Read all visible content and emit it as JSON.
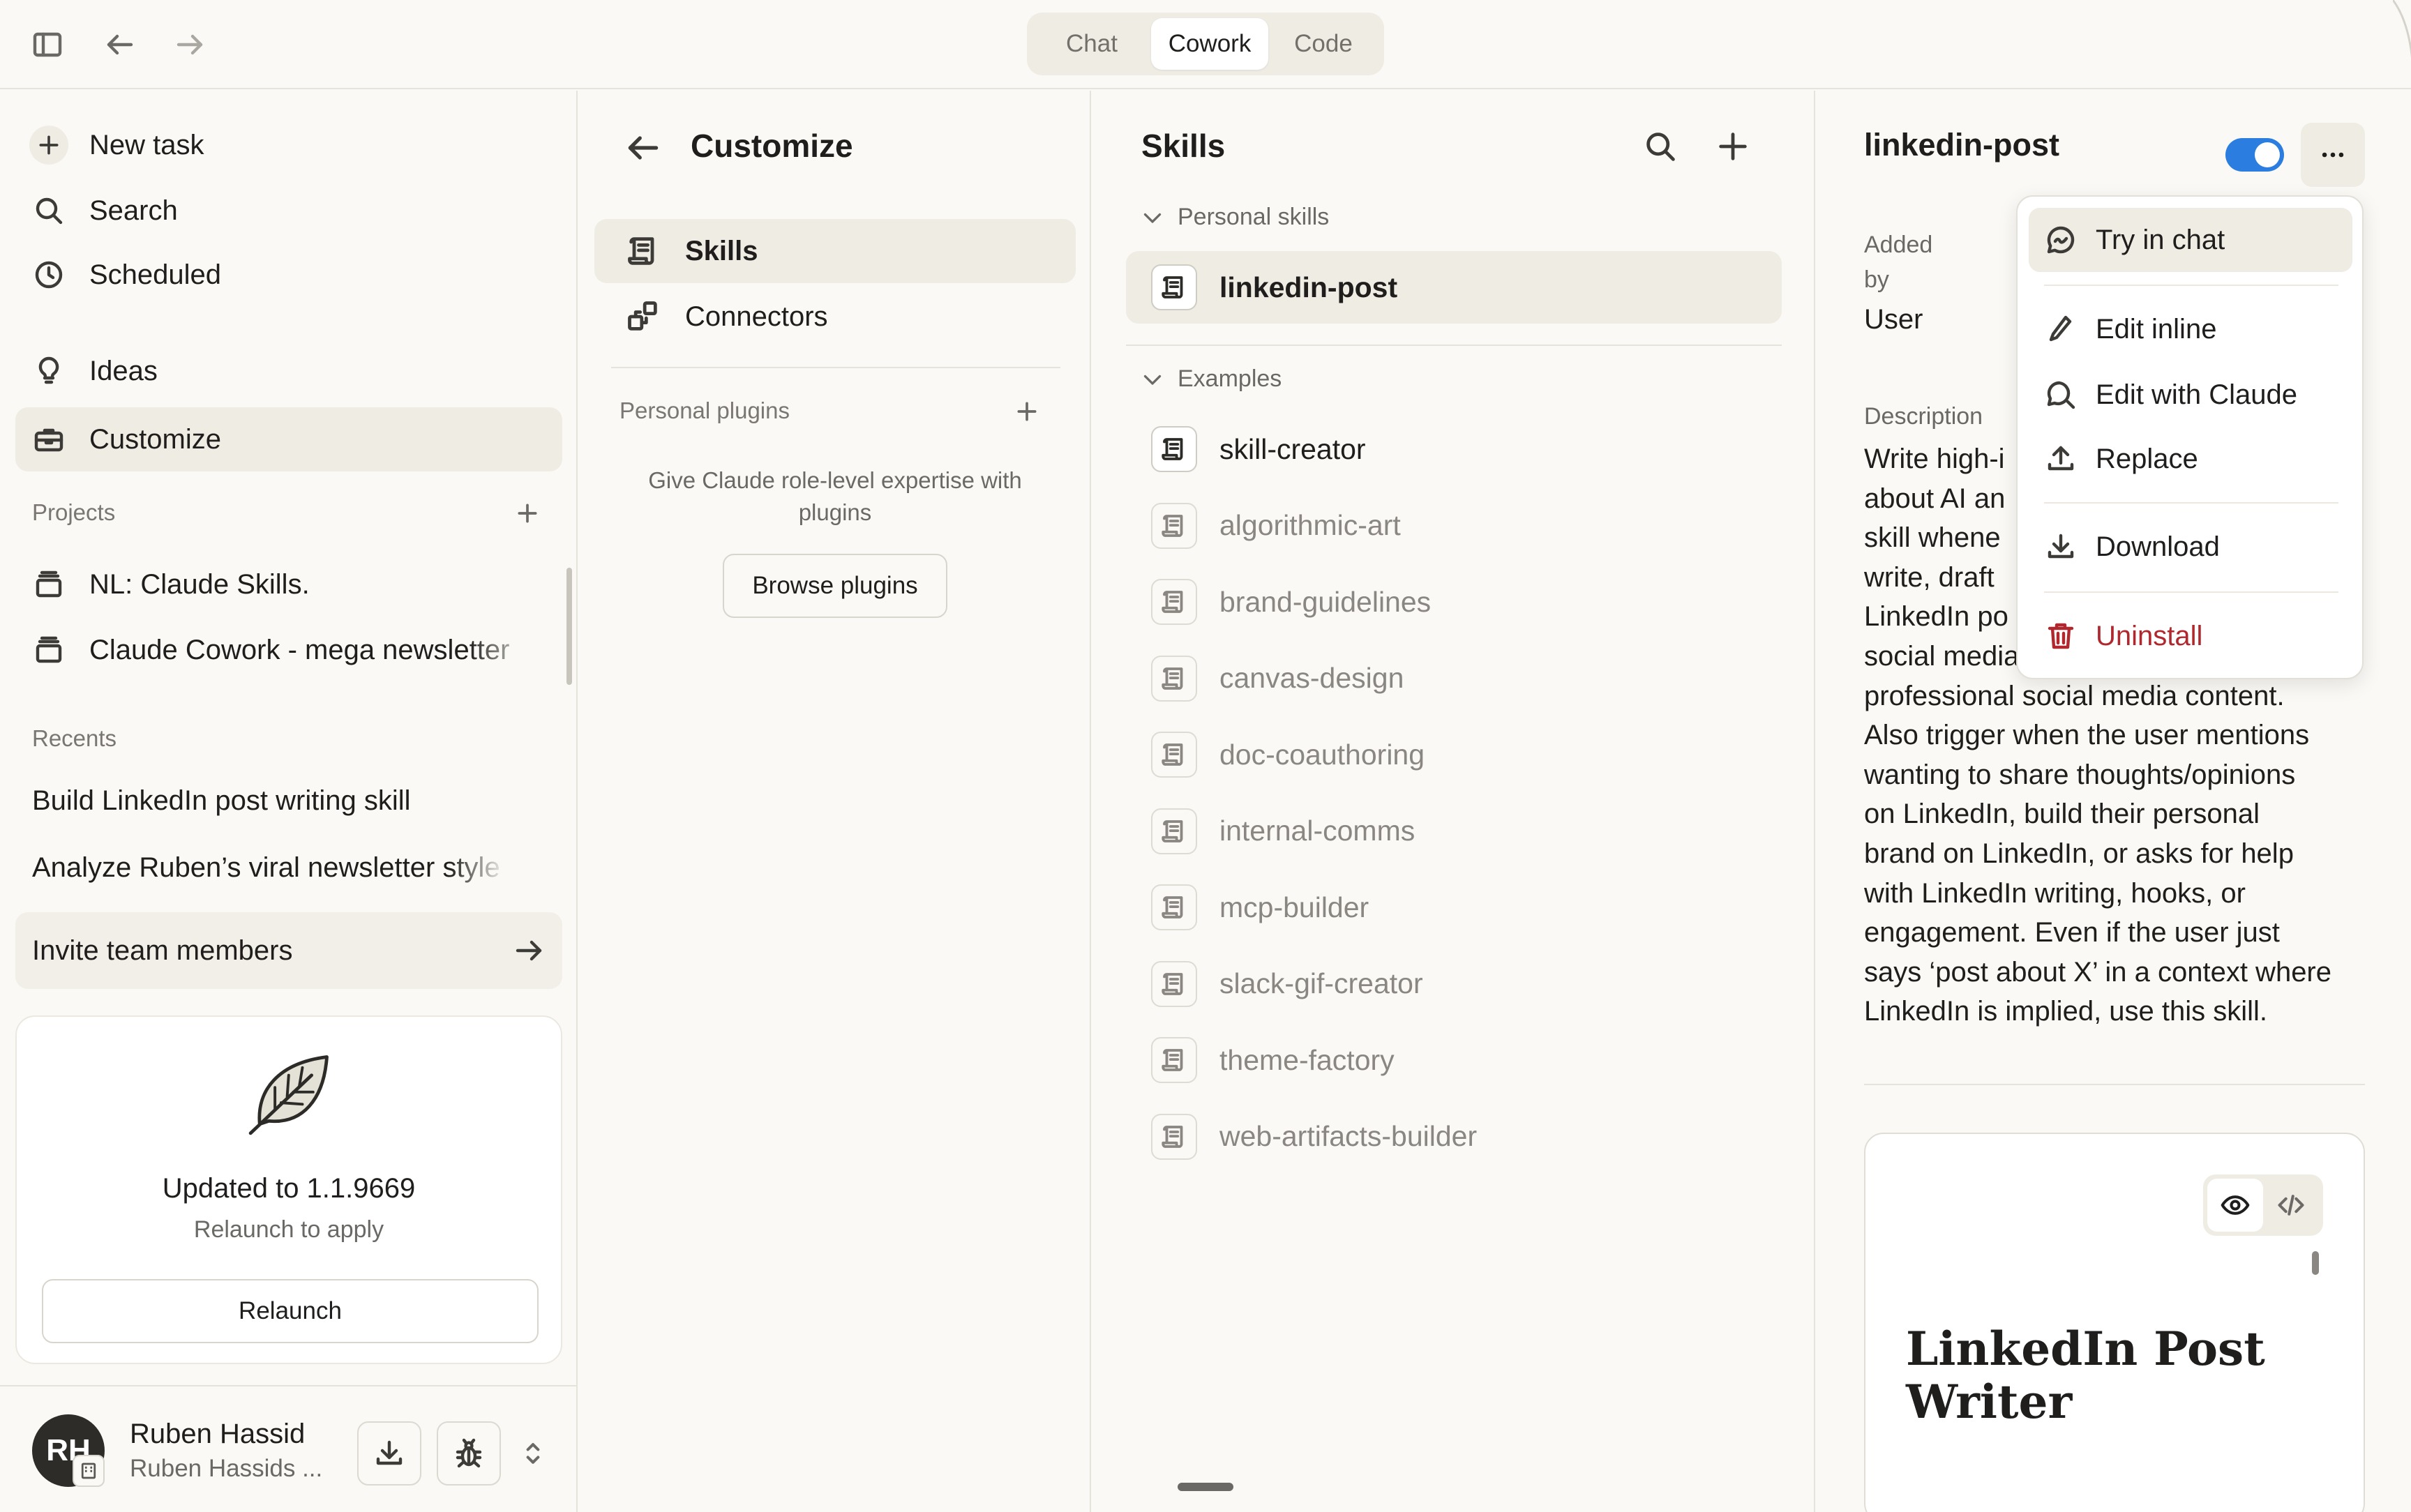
{
  "topbar": {
    "tabs": [
      {
        "label": "Chat",
        "active": false
      },
      {
        "label": "Cowork",
        "active": true
      },
      {
        "label": "Code",
        "active": false
      }
    ]
  },
  "sidebar": {
    "nav": [
      {
        "label": "New task",
        "icon": "plus-icon"
      },
      {
        "label": "Search",
        "icon": "search-icon"
      },
      {
        "label": "Scheduled",
        "icon": "clock-icon"
      },
      {
        "label": "Ideas",
        "icon": "lightbulb-icon"
      },
      {
        "label": "Customize",
        "icon": "toolbox-icon",
        "active": true
      }
    ],
    "projects_label": "Projects",
    "projects": [
      "NL: Claude Skills.",
      "Claude Cowork - mega newsletter"
    ],
    "recents_label": "Recents",
    "recents": [
      "Build LinkedIn post writing skill",
      "Analyze Ruben’s viral newsletter style"
    ],
    "invite_label": "Invite team members",
    "update": {
      "title": "Updated to 1.1.9669",
      "subtitle": "Relaunch to apply",
      "button": "Relaunch"
    },
    "user": {
      "initials": "RH",
      "name": "Ruben Hassid",
      "org": "Ruben Hassids ..."
    }
  },
  "customize": {
    "title": "Customize",
    "items": [
      {
        "label": "Skills",
        "active": true
      },
      {
        "label": "Connectors",
        "active": false
      }
    ],
    "plugins_label": "Personal plugins",
    "plugins_empty": "Give Claude role-level expertise with plugins",
    "browse_button": "Browse plugins"
  },
  "skills": {
    "title": "Skills",
    "personal_label": "Personal skills",
    "personal": [
      "linkedin-post"
    ],
    "examples_label": "Examples",
    "examples": [
      "skill-creator",
      "algorithmic-art",
      "brand-guidelines",
      "canvas-design",
      "doc-coauthoring",
      "internal-comms",
      "mcp-builder",
      "slack-gif-creator",
      "theme-factory",
      "web-artifacts-builder"
    ]
  },
  "detail": {
    "title": "linkedin-post",
    "enabled": true,
    "added_label": "Added by",
    "added_value": "User",
    "description_label": "Description",
    "description_lines": [
      "Write high-i",
      "about AI an",
      "skill whene",
      "write, draft",
      "LinkedIn po",
      "social media",
      "professional social media content.",
      "Also trigger when the user mentions",
      "wanting to share thoughts/opinions",
      "on LinkedIn, build their personal",
      "brand on LinkedIn, or asks for help",
      "with LinkedIn writing, hooks, or",
      "engagement. Even if the user just",
      "says ‘post about X’ in a context where",
      "LinkedIn is implied, use this skill."
    ],
    "preview_heading": "LinkedIn Post Writer"
  },
  "menu": {
    "items": [
      {
        "label": "Try in chat",
        "icon": "chat-icon"
      },
      {
        "label": "Edit inline",
        "icon": "pencil-icon"
      },
      {
        "label": "Edit with Claude",
        "icon": "chat-search-icon"
      },
      {
        "label": "Replace",
        "icon": "upload-icon"
      },
      {
        "label": "Download",
        "icon": "download-icon"
      },
      {
        "label": "Uninstall",
        "icon": "trash-icon"
      }
    ]
  },
  "colors": {
    "accent_toggle": "#2b7de0",
    "danger": "#b0282e",
    "background": "#faf9f5",
    "active_item": "#efece4"
  }
}
